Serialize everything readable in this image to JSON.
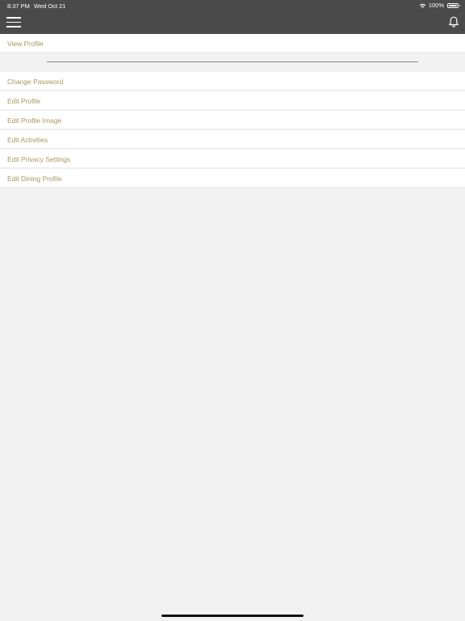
{
  "status_bar": {
    "time": "8:37 PM",
    "date": "Wed Oct 21",
    "battery": "100%",
    "battery_level_percent": 100
  },
  "header": {
    "menu_icon": "hamburger-menu-icon",
    "notification_icon": "bell-icon"
  },
  "colors": {
    "nav_background": "#4a4a4a",
    "link_text": "#a8965f",
    "page_background": "#f2f2f2",
    "row_background": "#ffffff"
  },
  "profile": {
    "view_profile": "View Profile"
  },
  "settings_items": [
    {
      "label": "Change Password"
    },
    {
      "label": "Edit Profile"
    },
    {
      "label": "Edit Profile Image"
    },
    {
      "label": "Edit Activities"
    },
    {
      "label": "Edit Privacy Settings"
    },
    {
      "label": "Edit Dining Profile"
    }
  ]
}
